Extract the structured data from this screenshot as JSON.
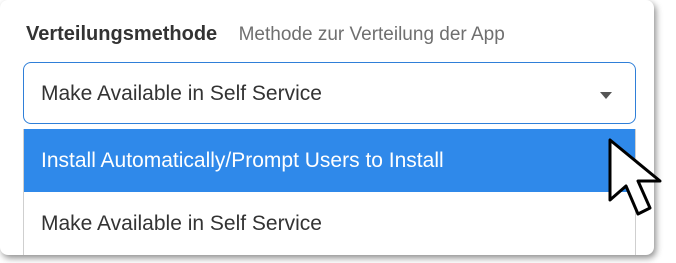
{
  "field": {
    "label": "Verteilungsmethode",
    "description": "Methode zur Verteilung der App"
  },
  "select": {
    "value": "Make Available in Self Service",
    "icon": "caret-down-icon"
  },
  "dropdown": {
    "options": [
      {
        "label": "Install Automatically/Prompt Users to Install",
        "highlighted": true
      },
      {
        "label": "Make Available in Self Service",
        "highlighted": false
      }
    ]
  },
  "colors": {
    "accent": "#2f89ea",
    "border": "#2f7fd8",
    "text": "#333333",
    "muted": "#6f6f6f"
  },
  "pointer": {
    "icon": "mouse-pointer-icon"
  }
}
